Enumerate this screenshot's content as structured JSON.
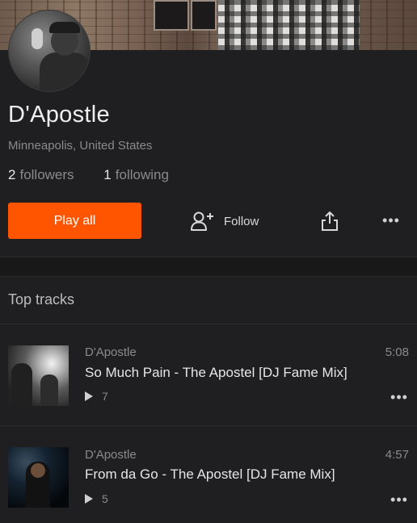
{
  "profile": {
    "name": "D'Apostle",
    "location": "Minneapolis, United States",
    "followers_count": "2",
    "followers_label": "followers",
    "following_count": "1",
    "following_label": "following"
  },
  "actions": {
    "play_all_label": "Play all",
    "follow_label": "Follow",
    "share_icon": "share-icon",
    "more_icon": "more-icon",
    "more_glyph": "•••"
  },
  "colors": {
    "accent": "#ff5500",
    "background": "#1f1f21"
  },
  "top_tracks": {
    "title": "Top tracks",
    "tracks": [
      {
        "artist": "D'Apostle",
        "title": "So Much Pain - The Apostel [DJ Fame Mix]",
        "plays": "7",
        "duration": "5:08"
      },
      {
        "artist": "D'Apostle",
        "title": "From da Go - The Apostel [DJ Fame Mix]",
        "plays": "5",
        "duration": "4:57"
      }
    ]
  }
}
